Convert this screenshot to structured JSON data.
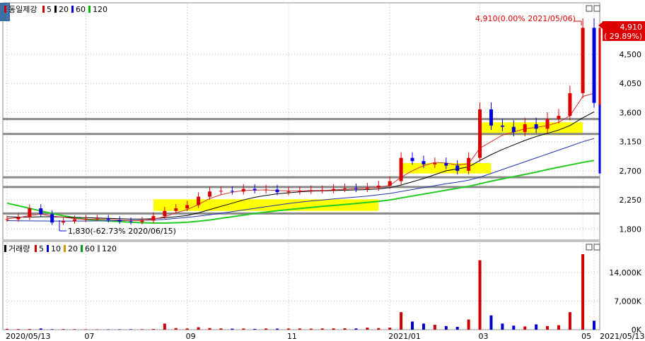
{
  "chart_data": [
    {
      "type": "candlestick",
      "legend": [
        {
          "label": "동일제강",
          "color": "#cc0000"
        },
        {
          "label": "5",
          "color": "#cc0000"
        },
        {
          "label": "20",
          "color": "#000000"
        },
        {
          "label": "60",
          "color": "#0000cc"
        },
        {
          "label": "120",
          "color": "#00bb00"
        }
      ],
      "yticks": [
        "4,500",
        "4,050",
        "3,600",
        "3,150",
        "2,700",
        "2,250",
        "1,800"
      ],
      "ylim": [
        1630,
        5100
      ],
      "current_price": "4,910",
      "current_change": "( 29.89%)",
      "high_annotation": "4,910(0.00% 2021/05/06)",
      "low_annotation": "1,830(-62.73% 2020/06/15)",
      "price": {
        "dates": [
          "2020-05-13",
          "2020-05-20",
          "2020-05-27",
          "2020-06-03",
          "2020-06-10",
          "2020-06-17",
          "2020-06-24",
          "2020-07-01",
          "2020-07-08",
          "2020-07-15",
          "2020-07-22",
          "2020-07-29",
          "2020-08-05",
          "2020-08-12",
          "2020-08-19",
          "2020-08-26",
          "2020-09-02",
          "2020-09-09",
          "2020-09-16",
          "2020-09-23",
          "2020-09-30",
          "2020-10-07",
          "2020-10-14",
          "2020-10-21",
          "2020-10-28",
          "2020-11-04",
          "2020-11-11",
          "2020-11-18",
          "2020-11-25",
          "2020-12-02",
          "2020-12-09",
          "2020-12-16",
          "2020-12-23",
          "2020-12-30",
          "2021-01-06",
          "2021-01-13",
          "2021-01-20",
          "2021-01-27",
          "2021-02-03",
          "2021-02-10",
          "2021-02-17",
          "2021-02-24",
          "2021-03-03",
          "2021-03-10",
          "2021-03-17",
          "2021-03-24",
          "2021-03-31",
          "2021-04-07",
          "2021-04-14",
          "2021-04-21",
          "2021-04-28",
          "2021-05-06",
          "2021-05-13"
        ],
        "close": [
          1950,
          1980,
          2120,
          2030,
          1900,
          1920,
          1950,
          1960,
          1960,
          1940,
          1920,
          1910,
          1930,
          2000,
          2080,
          2120,
          2170,
          2300,
          2380,
          2390,
          2380,
          2420,
          2400,
          2410,
          2370,
          2380,
          2390,
          2400,
          2400,
          2420,
          2430,
          2420,
          2440,
          2470,
          2540,
          2900,
          2850,
          2800,
          2820,
          2780,
          2700,
          2900,
          3650,
          3400,
          3380,
          3300,
          3420,
          3350,
          3500,
          3550,
          3900,
          4910,
          3750
        ],
        "ma5": [
          1960,
          1975,
          2010,
          2030,
          2000,
          1985,
          1960,
          1950,
          1955,
          1950,
          1940,
          1930,
          1930,
          1955,
          1990,
          2050,
          2100,
          2180,
          2270,
          2330,
          2370,
          2395,
          2400,
          2405,
          2395,
          2390,
          2390,
          2395,
          2395,
          2405,
          2415,
          2425,
          2430,
          2445,
          2475,
          2600,
          2700,
          2780,
          2830,
          2820,
          2790,
          2810,
          3050,
          3150,
          3250,
          3300,
          3350,
          3370,
          3400,
          3450,
          3550,
          3850,
          3900
        ],
        "ma20": [
          1990,
          1985,
          1985,
          1990,
          1990,
          1985,
          1980,
          1975,
          1970,
          1965,
          1960,
          1955,
          1955,
          1960,
          1975,
          1990,
          2010,
          2050,
          2100,
          2150,
          2200,
          2250,
          2290,
          2320,
          2345,
          2360,
          2375,
          2385,
          2390,
          2395,
          2400,
          2405,
          2410,
          2420,
          2440,
          2480,
          2530,
          2580,
          2640,
          2700,
          2730,
          2760,
          2860,
          2950,
          3030,
          3100,
          3170,
          3230,
          3280,
          3330,
          3400,
          3520,
          3610
        ],
        "ma60": [
          1930,
          1928,
          1926,
          1925,
          1924,
          1923,
          1924,
          1925,
          1926,
          1928,
          1930,
          1932,
          1935,
          1940,
          1950,
          1965,
          1980,
          2000,
          2020,
          2045,
          2070,
          2095,
          2120,
          2145,
          2170,
          2195,
          2215,
          2235,
          2250,
          2265,
          2280,
          2295,
          2310,
          2330,
          2350,
          2380,
          2410,
          2440,
          2470,
          2500,
          2525,
          2555,
          2600,
          2660,
          2720,
          2780,
          2840,
          2900,
          2960,
          3020,
          3080,
          3150,
          3200
        ],
        "ma120": [
          2200,
          2160,
          2120,
          2080,
          2040,
          2005,
          1975,
          1950,
          1935,
          1925,
          1915,
          1905,
          1897,
          1893,
          1893,
          1897,
          1905,
          1920,
          1940,
          1965,
          1990,
          2015,
          2040,
          2062,
          2083,
          2100,
          2117,
          2133,
          2150,
          2165,
          2180,
          2195,
          2210,
          2228,
          2250,
          2280,
          2310,
          2340,
          2370,
          2400,
          2430,
          2460,
          2500,
          2540,
          2575,
          2610,
          2645,
          2680,
          2720,
          2755,
          2790,
          2830,
          2860
        ]
      },
      "horizontal_lines": [
        3500,
        3270,
        2600,
        2450,
        2040
      ],
      "highlight_zones": [
        {
          "from": "2020-08-12",
          "to": "2020-12-30",
          "ylow": 2080,
          "yhigh": 2260
        },
        {
          "from": "2021-01-13",
          "to": "2021-03-10",
          "ylow": 2660,
          "yhigh": 2820
        },
        {
          "from": "2021-03-03",
          "to": "2021-05-06",
          "ylow": 3250,
          "yhigh": 3450
        }
      ],
      "xlabels": [
        {
          "date": "2020-05-13",
          "label": "2020/05/13"
        },
        {
          "date": "2020-07-01",
          "label": "07"
        },
        {
          "date": "2020-09-02",
          "label": "09"
        },
        {
          "date": "2020-11-04",
          "label": "11"
        },
        {
          "date": "2021-01-06",
          "label": "2021/01"
        },
        {
          "date": "2021-03-03",
          "label": "03"
        },
        {
          "date": "2021-05-06",
          "label": "05"
        },
        {
          "date": "2021-05-13",
          "label": "2021/05/13"
        }
      ]
    },
    {
      "type": "bar",
      "legend": [
        {
          "label": "거래량",
          "color": "#000000"
        },
        {
          "label": "5",
          "color": "#cc0000"
        },
        {
          "label": "10",
          "color": "#0000cc"
        },
        {
          "label": "20",
          "color": "#cc9900"
        },
        {
          "label": "60",
          "color": "#009900"
        },
        {
          "label": "120",
          "color": "#888888"
        }
      ],
      "yticks": [
        "14,000K",
        "7,000K",
        "0K"
      ],
      "ylim": [
        0,
        18500
      ],
      "volume": [
        200,
        150,
        180,
        300,
        120,
        150,
        130,
        110,
        100,
        90,
        100,
        110,
        120,
        180,
        1500,
        400,
        300,
        600,
        400,
        300,
        250,
        280,
        200,
        300,
        250,
        280,
        300,
        250,
        300,
        320,
        350,
        300,
        500,
        400,
        500,
        4300,
        2000,
        1500,
        1200,
        900,
        700,
        2500,
        17000,
        3500,
        1500,
        1000,
        800,
        1300,
        900,
        1100,
        4300,
        18500,
        2200
      ]
    }
  ]
}
